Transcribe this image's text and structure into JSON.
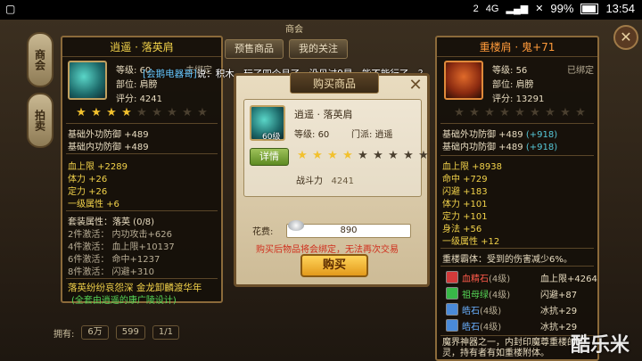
{
  "status_bar": {
    "time": "13:54",
    "battery": "99%",
    "network": "4G",
    "sim": "2"
  },
  "market": {
    "title": "商会",
    "tabs": [
      "预售商品",
      "我的关注"
    ],
    "side_tabs": [
      "商会",
      "拍卖"
    ],
    "bottom": {
      "own_label": "拥有:",
      "own_value": "6万",
      "gold_value": "599",
      "page": "1/1"
    }
  },
  "chat": {
    "speaker": "[会鹅电器哥]",
    "message": "说：积木，玩了四个月了，没见过9星，能不能行了。？"
  },
  "left_item": {
    "name": "逍遥 · 落英肩",
    "level_label": "等级:",
    "level": "60",
    "bind": "未绑定",
    "part_label": "部位:",
    "part": "肩膀",
    "school_label": "门派:",
    "school": "逍遥",
    "score_label": "评分:",
    "score": "4241",
    "stars_filled": 4,
    "stars_total": 9,
    "base_stats": [
      "基础外功防御 +489",
      "基础内功防御 +489"
    ],
    "attrs": [
      "血上限 +2289",
      "体力 +26",
      "定力 +26",
      "一级属性 +6"
    ],
    "set_title": "套装属性：落英 (0/8)",
    "set_bonus": [
      "2件激活： 内功攻击+626",
      "4件激活： 血上限+10137",
      "6件激活： 命中+1237",
      "8件激活： 闪避+310"
    ],
    "flavor": "落英纷纷哀怨深 金龙卸麟渡华年",
    "flavor_note": "(全套由逍遥的康广陵设计)"
  },
  "dialog": {
    "title": "购买商品",
    "item_name": "逍遥 · 落英肩",
    "level_label": "等级:",
    "level": "60",
    "school_label": "门派:",
    "school": "逍遥",
    "badge": "60级",
    "detail_button": "详情",
    "stars_filled": 4,
    "stars_total": 9,
    "power_label": "战斗力",
    "power": "4241",
    "cost_label": "花费:",
    "cost": "890",
    "warning": "购买后物品将会绑定，无法再次交易",
    "buy_button": "购买"
  },
  "right_item": {
    "name": "重楼肩 · 鬼",
    "enhance": "+71",
    "level_label": "等级:",
    "level": "56",
    "bind": "已绑定",
    "part_label": "部位:",
    "part": "肩膀",
    "score_label": "评分:",
    "score": "13291",
    "stars_filled": 0,
    "stars_total": 9,
    "base_stats": [
      {
        "text": "基础外功防御 +489",
        "bonus": "(+918)"
      },
      {
        "text": "基础内功防御 +489",
        "bonus": "(+918)"
      }
    ],
    "attrs": [
      "血上限 +8938",
      "命中 +729",
      "闪避 +183",
      "体力 +101",
      "定力 +101",
      "身法 +56",
      "一级属性 +12"
    ],
    "heavy": "重楼霸体：受到的伤害减少6%。",
    "gems": [
      {
        "name": "血精石",
        "lv": "(4级)",
        "stat": "血上限+4264",
        "color": "#d23a3a"
      },
      {
        "name": "祖母绿",
        "lv": "(4级)",
        "stat": "闪避+87",
        "color": "#38b848"
      },
      {
        "name": "皓石",
        "lv": "(4级)",
        "stat": "冰抗+29",
        "color": "#4a8ad8"
      },
      {
        "name": "皓石",
        "lv": "(4级)",
        "stat": "冰抗+29",
        "color": "#4a8ad8"
      }
    ],
    "lore": "魔界神器之一，内封印魔尊重楼的元灵，持有者有如重楼附体。"
  },
  "watermark": "酷乐米"
}
